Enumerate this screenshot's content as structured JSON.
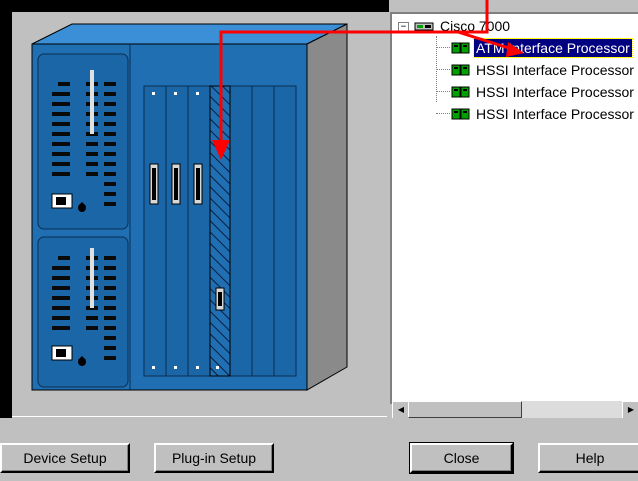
{
  "tree": {
    "root_label": "Cisco 7000",
    "items": [
      {
        "label": "ATM Interface Processor",
        "selected": true
      },
      {
        "label": "HSSI Interface Processor",
        "selected": false
      },
      {
        "label": "HSSI Interface Processor",
        "selected": false
      },
      {
        "label": "HSSI Interface Processor",
        "selected": false
      }
    ]
  },
  "buttons": {
    "device_setup": "Device Setup",
    "plugin_setup": "Plug-in Setup",
    "close": "Close",
    "help": "Help"
  },
  "icons": {
    "router_icon": "router-icon",
    "card_icon": "interface-card-icon",
    "chassis": "cisco-7000-chassis-image"
  },
  "colors": {
    "chassis_blue": "#1f6fb2",
    "arrow_red": "#ff0000",
    "selection": "#000080",
    "card_icon_green": "#00a000"
  }
}
